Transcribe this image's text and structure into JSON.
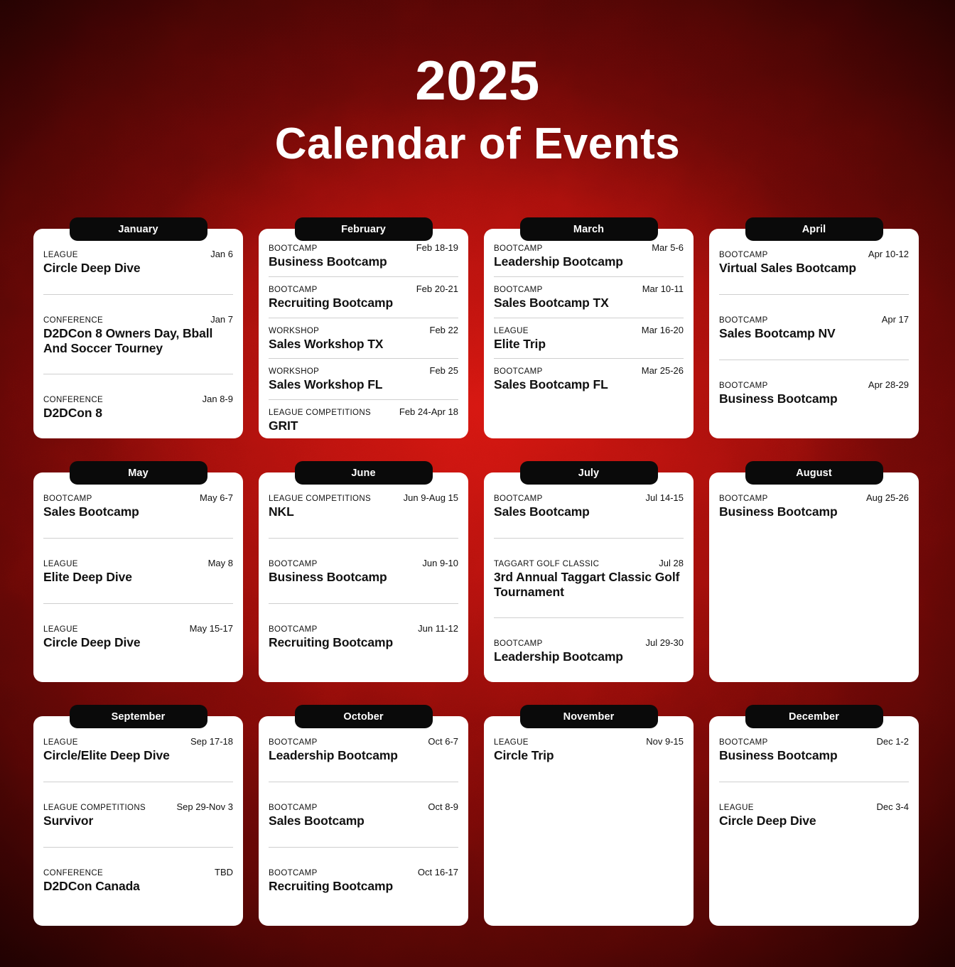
{
  "header": {
    "year": "2025",
    "subtitle": "Calendar of Events"
  },
  "colors": {
    "background_deep": "#3a0303",
    "background_bright": "#c8140f",
    "tab": "#0a0a0a",
    "card": "#ffffff",
    "text": "#111111",
    "divider": "#cfcfcf",
    "header_text": "#ffffff"
  },
  "months": [
    {
      "name": "January",
      "density": "loose",
      "events": [
        {
          "category": "LEAGUE",
          "date": "Jan 6",
          "title": "Circle Deep Dive"
        },
        {
          "category": "CONFERENCE",
          "date": "Jan 7",
          "title": "D2DCon 8 Owners Day, Bball And Soccer Tourney"
        },
        {
          "category": "CONFERENCE",
          "date": "Jan 8-9",
          "title": "D2DCon 8"
        }
      ]
    },
    {
      "name": "February",
      "density": "tight",
      "events": [
        {
          "category": "BOOTCAMP",
          "date": "Feb 18-19",
          "title": "Business Bootcamp"
        },
        {
          "category": "BOOTCAMP",
          "date": "Feb 20-21",
          "title": "Recruiting Bootcamp"
        },
        {
          "category": "WORKSHOP",
          "date": "Feb 22",
          "title": "Sales Workshop TX"
        },
        {
          "category": "WORKSHOP",
          "date": "Feb 25",
          "title": "Sales Workshop FL"
        },
        {
          "category": "LEAGUE COMPETITIONS",
          "date": "Feb 24-Apr 18",
          "title": "GRIT"
        }
      ]
    },
    {
      "name": "March",
      "density": "tight",
      "events": [
        {
          "category": "BOOTCAMP",
          "date": "Mar 5-6",
          "title": "Leadership Bootcamp"
        },
        {
          "category": "BOOTCAMP",
          "date": "Mar 10-11",
          "title": "Sales Bootcamp TX"
        },
        {
          "category": "LEAGUE",
          "date": "Mar 16-20",
          "title": "Elite Trip"
        },
        {
          "category": "BOOTCAMP",
          "date": "Mar 25-26",
          "title": "Sales Bootcamp FL"
        }
      ]
    },
    {
      "name": "April",
      "density": "loose",
      "events": [
        {
          "category": "BOOTCAMP",
          "date": "Apr 10-12",
          "title": "Virtual Sales Bootcamp"
        },
        {
          "category": "BOOTCAMP",
          "date": "Apr 17",
          "title": "Sales Bootcamp NV"
        },
        {
          "category": "BOOTCAMP",
          "date": "Apr 28-29",
          "title": "Business Bootcamp"
        }
      ]
    },
    {
      "name": "May",
      "density": "loose",
      "events": [
        {
          "category": "BOOTCAMP",
          "date": "May 6-7",
          "title": "Sales Bootcamp"
        },
        {
          "category": "LEAGUE",
          "date": "May 8",
          "title": "Elite Deep Dive"
        },
        {
          "category": "LEAGUE",
          "date": "May 15-17",
          "title": "Circle Deep Dive"
        }
      ]
    },
    {
      "name": "June",
      "density": "loose",
      "events": [
        {
          "category": "LEAGUE COMPETITIONS",
          "date": "Jun 9-Aug 15",
          "title": "NKL"
        },
        {
          "category": "BOOTCAMP",
          "date": "Jun 9-10",
          "title": "Business Bootcamp"
        },
        {
          "category": "BOOTCAMP",
          "date": "Jun 11-12",
          "title": "Recruiting Bootcamp"
        }
      ]
    },
    {
      "name": "July",
      "density": "loose",
      "events": [
        {
          "category": "BOOTCAMP",
          "date": "Jul 14-15",
          "title": "Sales Bootcamp"
        },
        {
          "category": "TAGGART GOLF CLASSIC",
          "date": "Jul 28",
          "title": "3rd Annual Taggart Classic Golf Tournament"
        },
        {
          "category": "BOOTCAMP",
          "date": "Jul 29-30",
          "title": "Leadership Bootcamp"
        }
      ]
    },
    {
      "name": "August",
      "density": "loose",
      "events": [
        {
          "category": "BOOTCAMP",
          "date": "Aug 25-26",
          "title": "Business Bootcamp"
        }
      ]
    },
    {
      "name": "September",
      "density": "loose",
      "events": [
        {
          "category": "LEAGUE",
          "date": "Sep 17-18",
          "title": "Circle/Elite Deep Dive"
        },
        {
          "category": "LEAGUE COMPETITIONS",
          "date": "Sep 29-Nov 3",
          "title": "Survivor"
        },
        {
          "category": "CONFERENCE",
          "date": "TBD",
          "title": "D2DCon Canada"
        }
      ]
    },
    {
      "name": "October",
      "density": "loose",
      "events": [
        {
          "category": "BOOTCAMP",
          "date": "Oct 6-7",
          "title": "Leadership Bootcamp"
        },
        {
          "category": "BOOTCAMP",
          "date": "Oct 8-9",
          "title": "Sales Bootcamp"
        },
        {
          "category": "BOOTCAMP",
          "date": "Oct 16-17",
          "title": "Recruiting Bootcamp"
        }
      ]
    },
    {
      "name": "November",
      "density": "loose",
      "events": [
        {
          "category": "LEAGUE",
          "date": "Nov 9-15",
          "title": "Circle Trip"
        }
      ]
    },
    {
      "name": "December",
      "density": "loose",
      "events": [
        {
          "category": "BOOTCAMP",
          "date": "Dec 1-2",
          "title": "Business Bootcamp"
        },
        {
          "category": "LEAGUE",
          "date": "Dec 3-4",
          "title": "Circle Deep Dive"
        }
      ]
    }
  ]
}
